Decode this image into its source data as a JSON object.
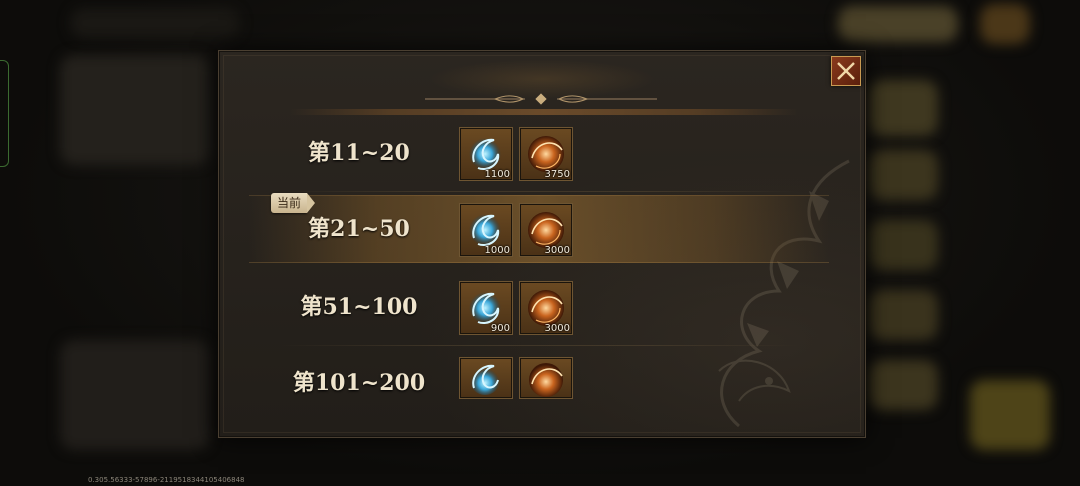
{
  "current_badge": "当前",
  "rows": [
    {
      "rank": "第11~20",
      "blue_qty": "1100",
      "orange_qty": "3750",
      "current": false
    },
    {
      "rank": "第21~50",
      "blue_qty": "1000",
      "orange_qty": "3000",
      "current": true
    },
    {
      "rank": "第51~100",
      "blue_qty": "900",
      "orange_qty": "3000",
      "current": false
    },
    {
      "rank": "第101~200",
      "blue_qty": "",
      "orange_qty": "",
      "current": false
    }
  ],
  "items": {
    "blue_icon": "blue-crystal-orb-icon",
    "orange_icon": "orange-fire-orb-icon"
  },
  "build_info": "0.305.56333-57896-2119518344105406848",
  "colors": {
    "panel_bg": "#2b2620",
    "text": "#efe4cc",
    "highlight": "#96683a",
    "close_red": "#8a3a1c"
  }
}
